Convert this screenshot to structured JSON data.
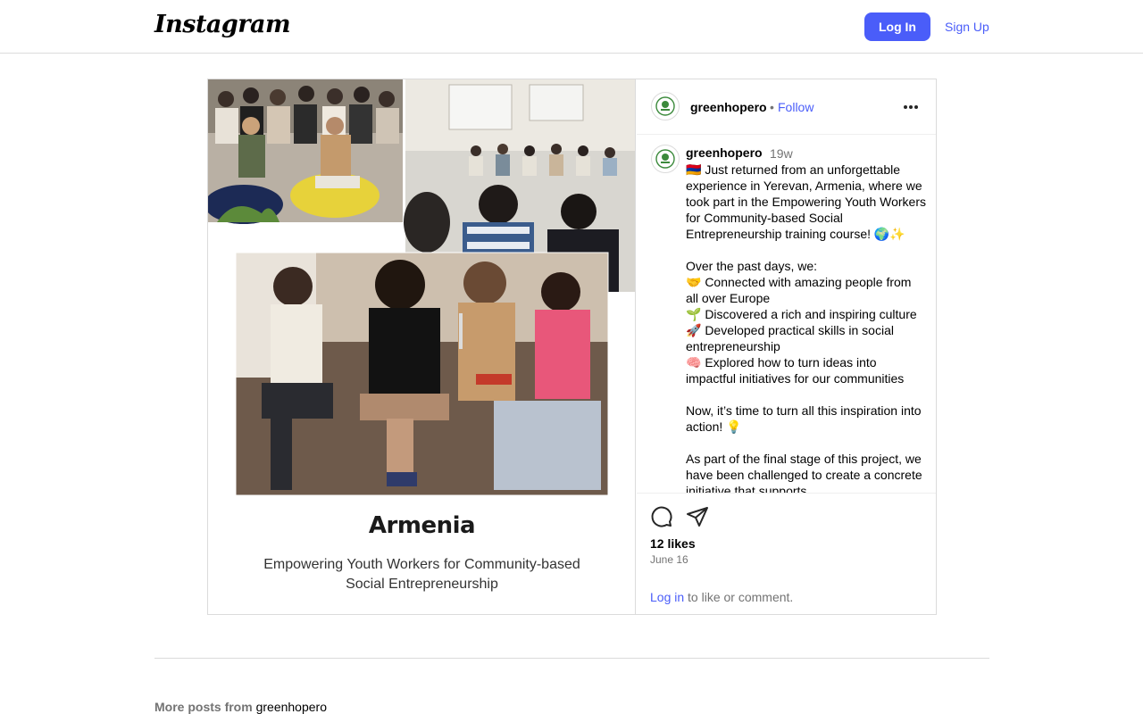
{
  "header": {
    "logo_text": "Instagram",
    "login_label": "Log In",
    "signup_label": "Sign Up"
  },
  "post": {
    "username": "greenhopero",
    "separator": "•",
    "follow_label": "Follow",
    "more_icon": "more-horizontal-icon",
    "caption": {
      "username": "greenhopero",
      "age": "19w",
      "text": "🇦🇲 Just returned from an unforgettable experience in Yerevan, Armenia, where we took part in the Empowering Youth Workers for Community-based Social Entrepreneurship training course! 🌍✨\n\nOver the past days, we:\n🤝 Connected with amazing people from all over Europe\n🌱 Discovered a rich and inspiring culture\n🚀 Developed practical skills in social entrepreneurship\n🧠 Explored how to turn ideas into impactful initiatives for our communities\n\nNow, it’s time to turn all this inspiration into action! 💡\n\nAs part of the final stage of this project, we have been challenged to create a concrete initiative that supports"
    },
    "likes": "12 likes",
    "date": "June 16",
    "login_prompt_link": "Log in",
    "login_prompt_rest": " to like or comment.",
    "media": {
      "title": "Armenia",
      "subtitle": "Empowering Youth Workers for Community-based Social Entrepreneurship"
    }
  },
  "footer": {
    "more_posts_prefix": "More posts from ",
    "more_posts_user": "greenhopero"
  },
  "colors": {
    "accent": "#4a5df9",
    "border": "#dbdbdb",
    "muted": "#737373"
  }
}
